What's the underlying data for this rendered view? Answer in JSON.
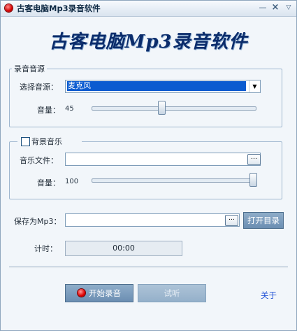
{
  "window": {
    "title": "古客电脑Mp3录音软件"
  },
  "title_buttons": {
    "minimize": "—",
    "close": "×",
    "maximize": "▽"
  },
  "heading": "古客电脑Mp3录音软件",
  "source_group": {
    "legend": "录音音源",
    "source_label": "选择音源：",
    "source_value": "麦克风",
    "volume_label": "音量：",
    "volume_value": "45",
    "volume_level": 0.45
  },
  "music_group": {
    "checkbox_label": "背景音乐",
    "checked": false,
    "file_label": "音乐文件：",
    "file_value": "",
    "browse_label": "…",
    "volume_label": "音量：",
    "volume_value": "100",
    "volume_level": 1.0
  },
  "save": {
    "label": "保存为Mp3：",
    "value": "",
    "browse_label": "…",
    "open_dir_label": "打开目录"
  },
  "timer": {
    "label": "计时：",
    "value": "00:00"
  },
  "actions": {
    "start_label": "开始录音",
    "audition_label": "试听",
    "about_label": "关于"
  }
}
